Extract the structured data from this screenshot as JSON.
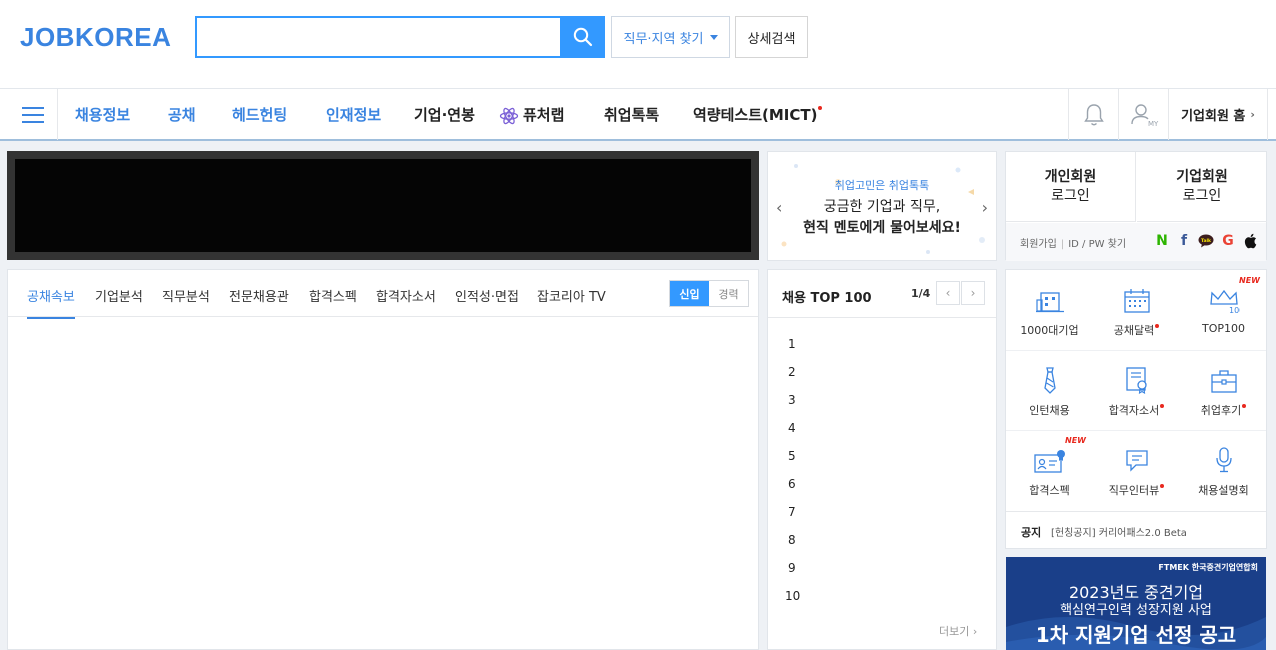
{
  "header": {
    "logo": "JOBKOREA",
    "search_placeholder": "",
    "filter_label": "직무·지역 찾기",
    "detail_search_label": "상세검색"
  },
  "nav": {
    "items": [
      {
        "label": "채용정보",
        "style": "blue"
      },
      {
        "label": "공채",
        "style": "blue"
      },
      {
        "label": "헤드헌팅",
        "style": "blue"
      },
      {
        "label": "인재정보",
        "style": "blue"
      },
      {
        "label": "기업·연봉",
        "style": "dark"
      },
      {
        "label": "퓨처랩",
        "style": "dark"
      },
      {
        "label": "취업톡톡",
        "style": "dark"
      },
      {
        "label": "역량테스트(MICT)",
        "style": "dark"
      }
    ],
    "my_label": "MY",
    "corp_home": "기업회원 홈"
  },
  "promo": {
    "line1": "취업고민은 취업톡톡",
    "line2": "궁금한 기업과 직무,",
    "line3": "현직 멘토에게 물어보세요!"
  },
  "login": {
    "personal": [
      "개인회원",
      "로그인"
    ],
    "corporate": [
      "기업회원",
      "로그인"
    ],
    "signup": "회원가입",
    "find": "ID / PW 찾기",
    "sns": [
      "N",
      "f",
      "Talk",
      "G",
      "apple"
    ]
  },
  "news": {
    "tabs": [
      "공채속보",
      "기업분석",
      "직무분석",
      "전문채용관",
      "합격스펙",
      "합격자소서",
      "인적성·면접",
      "잡코리아 TV"
    ],
    "toggle": [
      "신입",
      "경력"
    ]
  },
  "top100": {
    "title": "채용 TOP 100",
    "page": "1/4",
    "ranks": [
      "1",
      "2",
      "3",
      "4",
      "5",
      "6",
      "7",
      "8",
      "9",
      "10"
    ],
    "more": "더보기"
  },
  "services": {
    "items": [
      {
        "label": "1000대기업",
        "icon": "building-icon",
        "dot": false,
        "new": false
      },
      {
        "label": "공채달력",
        "icon": "calendar-icon",
        "dot": true,
        "new": false
      },
      {
        "label": "TOP100",
        "icon": "crown-icon",
        "dot": false,
        "new": true
      },
      {
        "label": "인턴채용",
        "icon": "necktie-icon",
        "dot": false,
        "new": false
      },
      {
        "label": "합격자소서",
        "icon": "certificate-icon",
        "dot": true,
        "new": false
      },
      {
        "label": "취업후기",
        "icon": "briefcase-icon",
        "dot": true,
        "new": false
      },
      {
        "label": "합격스펙",
        "icon": "id-card-icon",
        "dot": false,
        "new": true
      },
      {
        "label": "직무인터뷰",
        "icon": "chat-icon",
        "dot": true,
        "new": false
      },
      {
        "label": "채용설명회",
        "icon": "microphone-icon",
        "dot": false,
        "new": false
      }
    ],
    "new_badge": "NEW",
    "notice_label": "공지",
    "notice_text": "[헌칭공지] 커리어패스2.0 Beta"
  },
  "ad": {
    "brand": "FTMEK 한국중견기업연합회",
    "line1": "2023년도 중견기업",
    "line2": "핵심연구인력 성장지원 사업",
    "line3": "1차 지원기업 선정 공고"
  },
  "colors": {
    "brand_blue": "#3a84e0",
    "search_blue": "#3399ff",
    "dot_red": "#e8291e",
    "ad_navy": "#1a3f89"
  }
}
